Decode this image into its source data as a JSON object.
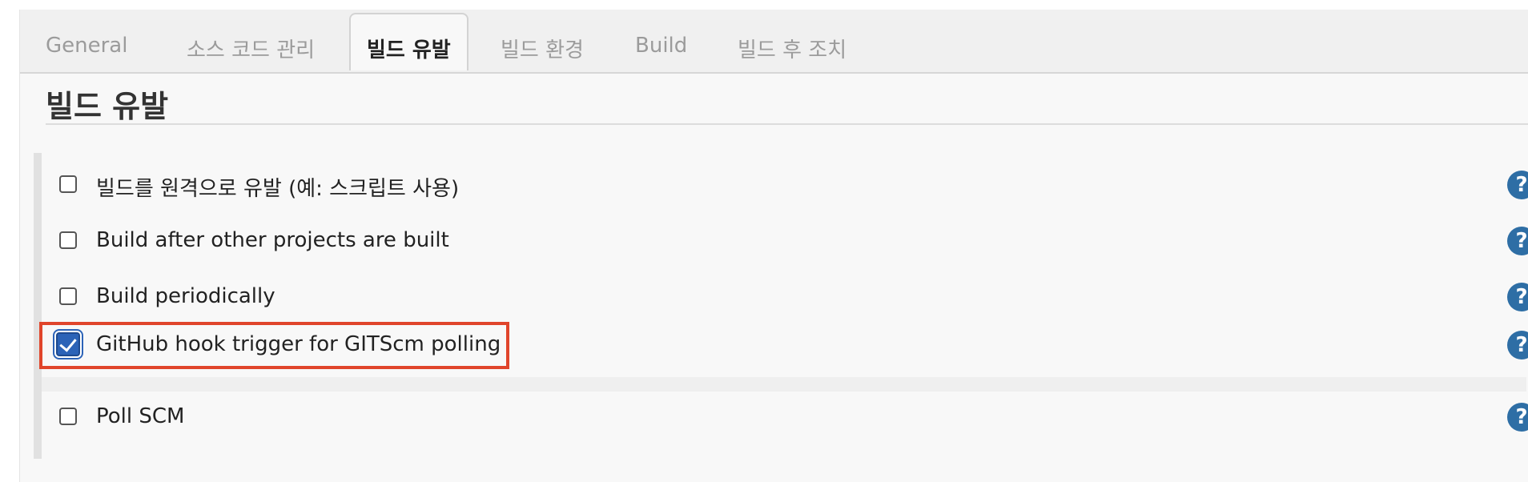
{
  "tabs": [
    {
      "label": "General",
      "active": false
    },
    {
      "label": "소스 코드 관리",
      "active": false
    },
    {
      "label": "빌드 유발",
      "active": true
    },
    {
      "label": "빌드 환경",
      "active": false
    },
    {
      "label": "Build",
      "active": false
    },
    {
      "label": "빌드 후 조치",
      "active": false
    }
  ],
  "section": {
    "title": "빌드 유발"
  },
  "triggers": [
    {
      "label": "빌드를 원격으로 유발 (예: 스크립트 사용)",
      "checked": false
    },
    {
      "label": "Build after other projects are built",
      "checked": false
    },
    {
      "label": "Build periodically",
      "checked": false
    },
    {
      "label": "GitHub hook trigger for GITScm polling",
      "checked": true
    },
    {
      "label": "Poll SCM",
      "checked": false
    }
  ],
  "help": {
    "glyph": "?",
    "icon": "help-icon"
  },
  "colors": {
    "accent": "#2c63b7",
    "help_icon": "#2e6ea5",
    "highlight_border": "#e0452b"
  }
}
